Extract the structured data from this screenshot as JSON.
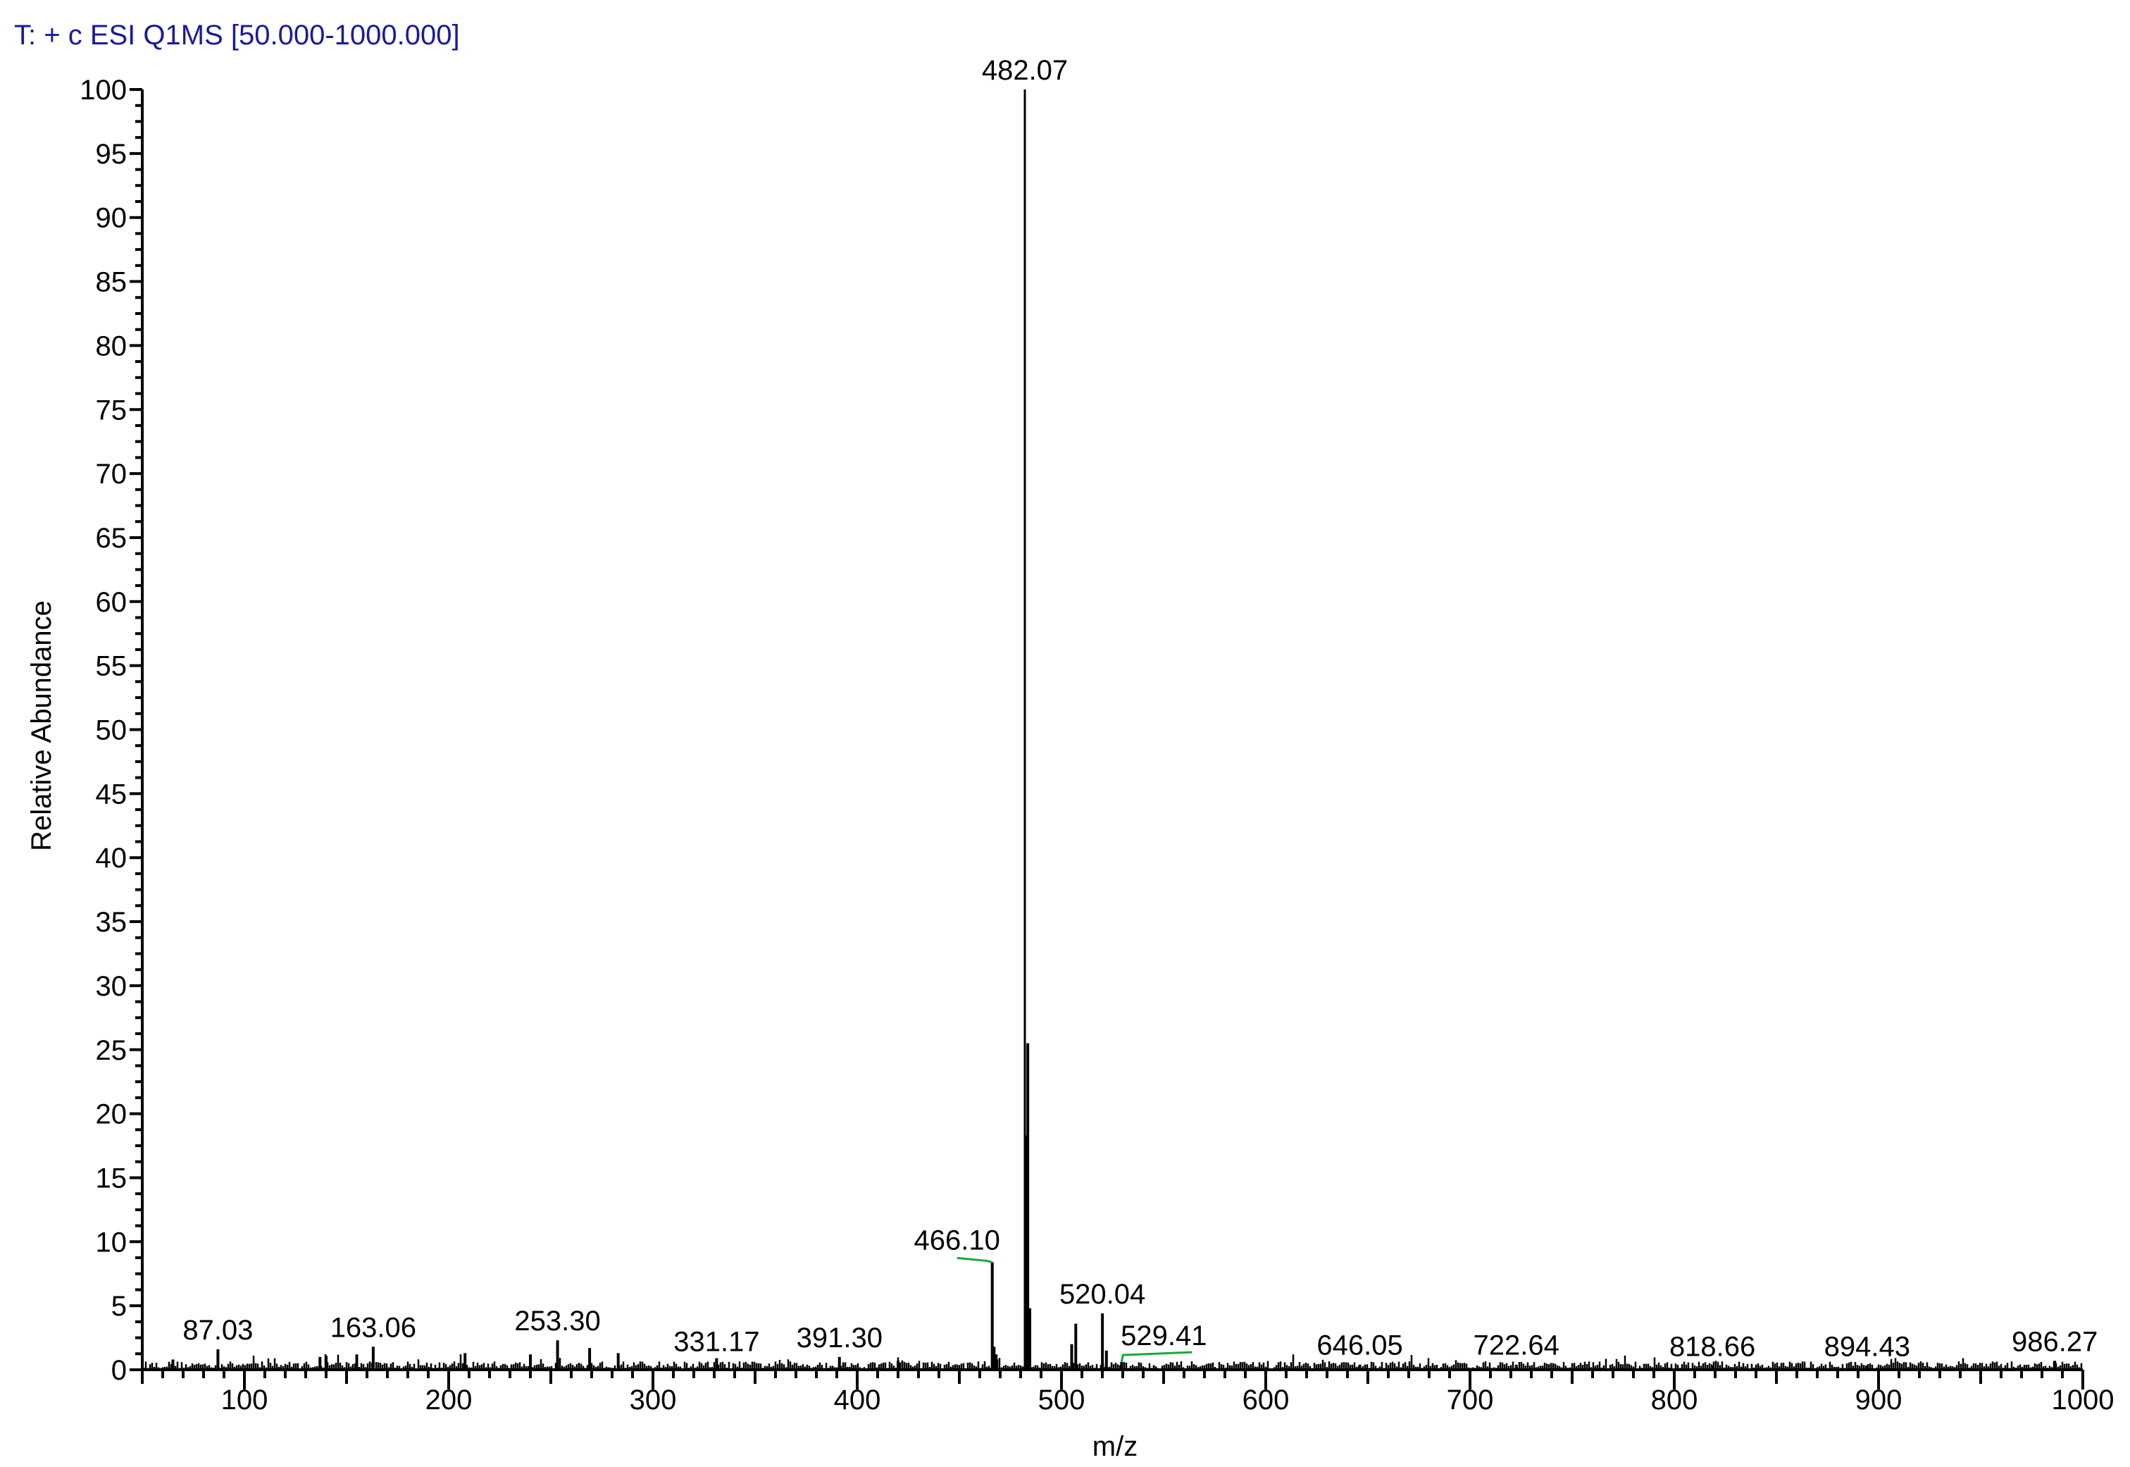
{
  "chart_data": {
    "type": "bar",
    "title": "T: + c ESI Q1MS [50.000-1000.000]",
    "xlabel": "m/z",
    "ylabel": "Relative Abundance",
    "xlim": [
      50,
      1000
    ],
    "ylim": [
      0,
      100
    ],
    "xticks": [
      100,
      200,
      300,
      400,
      500,
      600,
      700,
      800,
      900,
      1000
    ],
    "yticks": [
      0,
      5,
      10,
      15,
      20,
      25,
      30,
      35,
      40,
      45,
      50,
      55,
      60,
      65,
      70,
      75,
      80,
      85,
      90,
      95,
      100
    ],
    "grid": false,
    "peaks": [
      {
        "mz": 65.0,
        "intensity": 0.8
      },
      {
        "mz": 87.03,
        "intensity": 1.6,
        "label": "87.03"
      },
      {
        "mz": 137.0,
        "intensity": 1.0
      },
      {
        "mz": 140.0,
        "intensity": 1.1
      },
      {
        "mz": 155.0,
        "intensity": 1.2
      },
      {
        "mz": 163.06,
        "intensity": 1.8,
        "label": "163.06"
      },
      {
        "mz": 208.0,
        "intensity": 1.3
      },
      {
        "mz": 240.0,
        "intensity": 1.2
      },
      {
        "mz": 253.3,
        "intensity": 2.3,
        "label": "253.30"
      },
      {
        "mz": 269.0,
        "intensity": 1.7
      },
      {
        "mz": 283.0,
        "intensity": 1.3
      },
      {
        "mz": 331.17,
        "intensity": 0.9,
        "label": "331.17"
      },
      {
        "mz": 391.3,
        "intensity": 1.0,
        "label": "391.30"
      },
      {
        "mz": 420.0,
        "intensity": 0.7
      },
      {
        "mz": 466.1,
        "intensity": 8.4,
        "label": "466.10"
      },
      {
        "mz": 467.0,
        "intensity": 1.8
      },
      {
        "mz": 468.0,
        "intensity": 1.2
      },
      {
        "mz": 482.07,
        "intensity": 100,
        "label": "482.07"
      },
      {
        "mz": 483.0,
        "intensity": 18.3
      },
      {
        "mz": 483.5,
        "intensity": 25.5
      },
      {
        "mz": 484.5,
        "intensity": 4.8
      },
      {
        "mz": 505.0,
        "intensity": 2.0
      },
      {
        "mz": 507.0,
        "intensity": 3.6
      },
      {
        "mz": 520.04,
        "intensity": 4.4,
        "label": "520.04"
      },
      {
        "mz": 522.0,
        "intensity": 1.5
      },
      {
        "mz": 529.41,
        "intensity": 0.6,
        "label": "529.41"
      },
      {
        "mz": 646.05,
        "intensity": 0.4,
        "label": "646.05"
      },
      {
        "mz": 722.64,
        "intensity": 0.4,
        "label": "722.64"
      },
      {
        "mz": 818.66,
        "intensity": 0.3,
        "label": "818.66"
      },
      {
        "mz": 894.43,
        "intensity": 0.3,
        "label": "894.43"
      },
      {
        "mz": 986.27,
        "intensity": 0.7,
        "label": "986.27"
      }
    ],
    "colors": {
      "title": "#1a1a9c",
      "peaks": "#000000",
      "connector": "#1aa83a"
    }
  }
}
